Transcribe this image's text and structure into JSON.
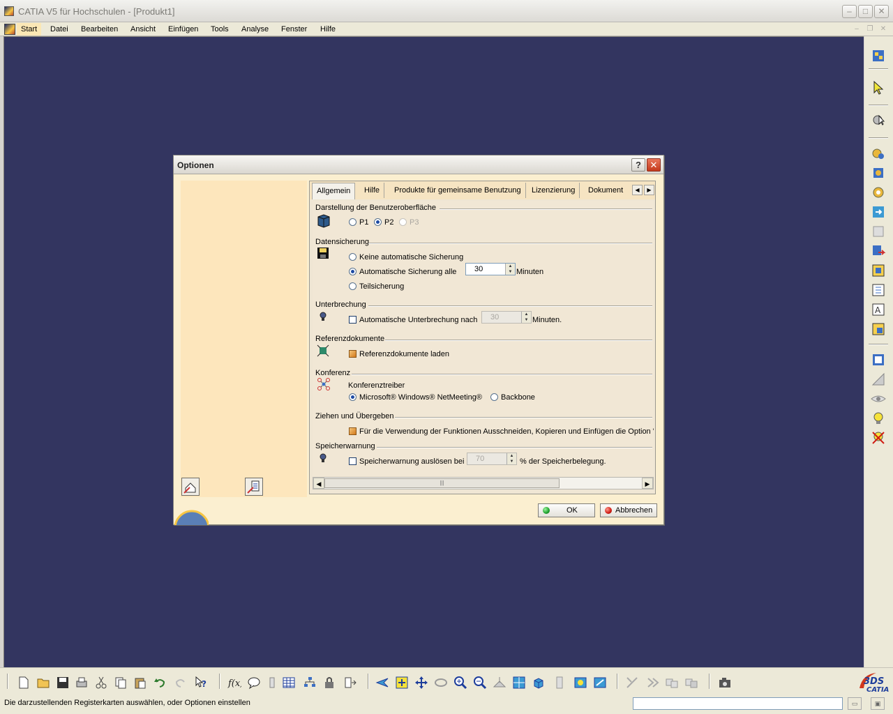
{
  "window": {
    "title": "CATIA V5 für Hochschulen - [Produkt1]"
  },
  "menu": {
    "items": [
      {
        "label": "Start"
      },
      {
        "label": "Datei"
      },
      {
        "label": "Bearbeiten"
      },
      {
        "label": "Ansicht"
      },
      {
        "label": "Einfügen"
      },
      {
        "label": "Tools"
      },
      {
        "label": "Analyse"
      },
      {
        "label": "Fenster"
      },
      {
        "label": "Hilfe"
      }
    ]
  },
  "dialog": {
    "title": "Optionen",
    "help_glyph": "?",
    "close_glyph": "✕",
    "tabs": [
      {
        "label": "Allgemein",
        "active": true
      },
      {
        "label": "Hilfe"
      },
      {
        "label": "Produkte für gemeinsame Benutzung"
      },
      {
        "label": "Lizenzierung"
      },
      {
        "label": "Dokument"
      }
    ],
    "sections": {
      "ui": {
        "title": "Darstellung der Benutzeroberfläche",
        "options": [
          {
            "label": "P1",
            "selected": false
          },
          {
            "label": "P2",
            "selected": true
          },
          {
            "label": "P3",
            "disabled": true
          }
        ]
      },
      "backup": {
        "title": "Datensicherung",
        "opt_none": "Keine automatische Sicherung",
        "opt_auto": "Automatische Sicherung alle",
        "opt_auto_value": "30",
        "opt_auto_unit": "Minuten",
        "opt_partial": "Teilsicherung"
      },
      "interrupt": {
        "title": "Unterbrechung",
        "label": "Automatische Unterbrechung nach",
        "value": "30",
        "unit": "Minuten."
      },
      "refdocs": {
        "title": "Referenzdokumente",
        "label": "Referenzdokumente laden"
      },
      "conference": {
        "title": "Konferenz",
        "driver_label": "Konferenztreiber",
        "opt_netmeeting": "Microsoft® Windows® NetMeeting®",
        "opt_backbone": "Backbone"
      },
      "dragdrop": {
        "title": "Ziehen und Übergeben",
        "label": "Für die Verwendung der Funktionen Ausschneiden, Kopieren und Einfügen die Option 'Z"
      },
      "memory": {
        "title": "Speicherwarnung",
        "label": "Speicherwarnung auslösen bei",
        "value": "70",
        "unit": "% der Speicherbelegung."
      }
    },
    "ok_label": "OK",
    "cancel_label": "Abbrechen"
  },
  "status": {
    "text": "Die darzustellenden Registerkarten auswählen, oder Optionen einstellen"
  },
  "colors": {
    "workspace": "#333560",
    "dialog_bg": "#fbefd0",
    "ok_led": "#1ea02c",
    "cancel_led": "#d01c12"
  }
}
